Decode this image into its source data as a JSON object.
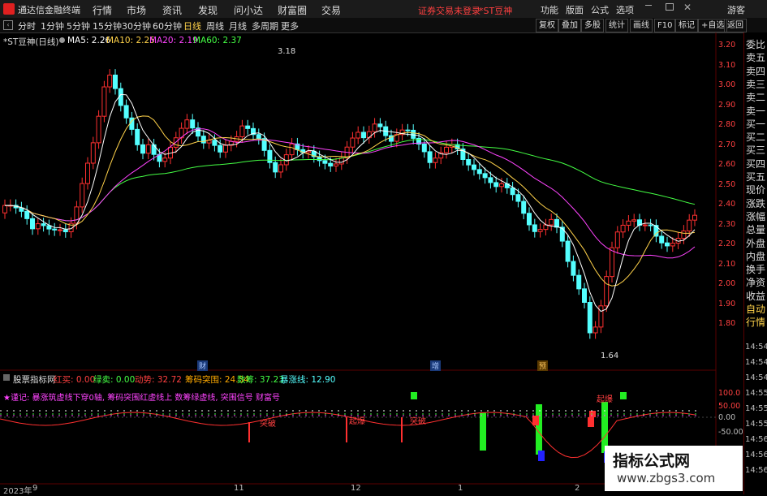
{
  "titlebar": {
    "app_name": "通达信金融终端",
    "menus": [
      "行情",
      "市场",
      "资讯",
      "发现",
      "问小达",
      "财富圈",
      "交易"
    ],
    "warning": "证券交易未登录",
    "stock_tag": "*ST豆神",
    "right_menus": [
      "功能",
      "版面",
      "公式",
      "选项"
    ],
    "guest": "游客"
  },
  "periods": [
    "分时",
    "1分钟",
    "5分钟",
    "15分钟",
    "30分钟",
    "60分钟",
    "日线",
    "周线",
    "月线",
    "多周期",
    "更多"
  ],
  "active_period": "日线",
  "tools": [
    "复权",
    "叠加",
    "多股",
    "统计",
    "画线",
    "F10",
    "标记",
    "+自选",
    "返回"
  ],
  "chart_header": {
    "name": "*ST豆神(日线)",
    "ma5": "MA5: 2.26",
    "ma10": "MA10: 2.25",
    "ma20": "MA20: 2.19",
    "ma60": "MA60: 2.37"
  },
  "colors": {
    "up": "#ff3030",
    "down": "#54ffff",
    "ma5": "#ffffff",
    "ma10": "#ffd24a",
    "ma20": "#ff44ff",
    "ma60": "#44ff44"
  },
  "price_axis": [
    "3.20",
    "3.10",
    "3.00",
    "2.90",
    "2.80",
    "2.70",
    "2.60",
    "2.50",
    "2.40",
    "2.30",
    "2.20",
    "2.10",
    "2.00",
    "1.90",
    "1.80"
  ],
  "high_label": "3.18",
  "low_label": "1.64",
  "side_items": [
    "委比",
    "卖五",
    "卖四",
    "卖三",
    "卖二",
    "卖一",
    "买一",
    "买二",
    "买三",
    "买四",
    "买五",
    "现价",
    "涨跌",
    "涨幅",
    "总量",
    "外盘",
    "内盘",
    "换手",
    "净资",
    "收益",
    "自动",
    "行情"
  ],
  "time_labels": [
    "14:54",
    "14:54",
    "14:54",
    "14:55",
    "14:55",
    "14:55",
    "14:56",
    "14:56",
    "14:56"
  ],
  "badges": [
    {
      "text": "财",
      "color": "#4a90ff"
    },
    {
      "text": "增",
      "color": "#4a90ff"
    },
    {
      "text": "预",
      "color": "#ffb020"
    }
  ],
  "indicator": {
    "name": "股票指标网",
    "red": "红买: 0.00",
    "green": "绿卖: 0.00",
    "momentum": "动势: 32.72",
    "chip": "筹码突围: 24.34",
    "count": "数筹: 37.23",
    "surge": "暴涨线: 12.90",
    "note": "★谨记: 暴涨筑虚线下穿0轴, 筹码突围红虚线上 数筹绿虚线, 突围信号 财富号",
    "axis": [
      "100.0",
      "50.00",
      "0.00",
      "-50.00"
    ],
    "markers": [
      "突破",
      "起爆",
      "突破",
      "起爆"
    ]
  },
  "date_axis": [
    "2023年",
    "9",
    "11",
    "12",
    "1",
    "2"
  ],
  "watermark": {
    "line1": "指标公式网",
    "line2": "www.zbgs3.com"
  }
}
